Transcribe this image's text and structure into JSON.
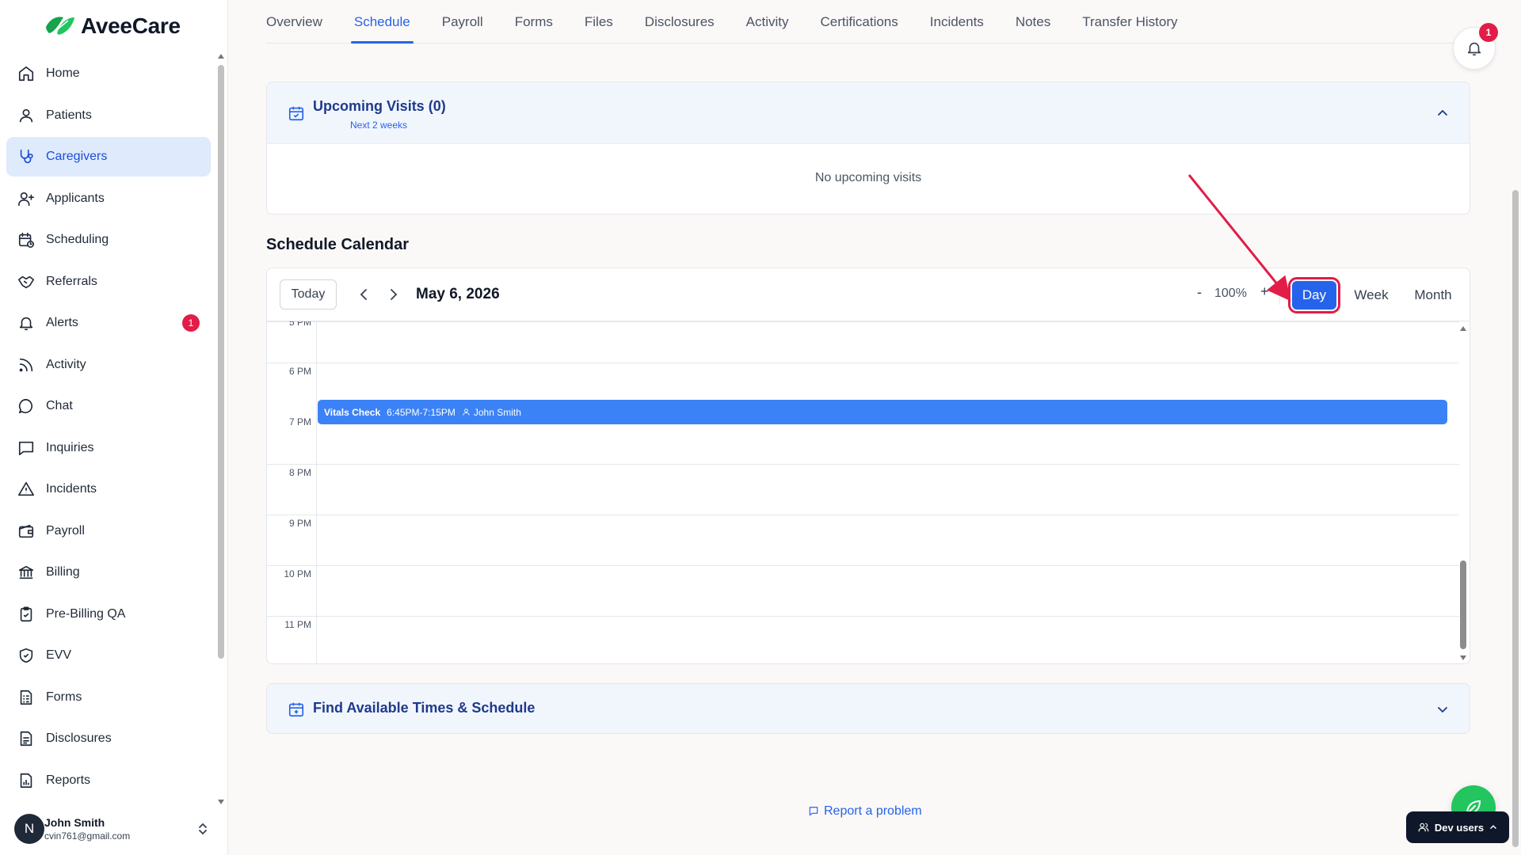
{
  "app": {
    "brand": "AveeCare"
  },
  "sidebar": {
    "items": [
      {
        "label": "Home",
        "icon": "home-icon"
      },
      {
        "label": "Patients",
        "icon": "user-icon"
      },
      {
        "label": "Caregivers",
        "icon": "stethoscope-icon",
        "active": true
      },
      {
        "label": "Applicants",
        "icon": "user-plus-icon"
      },
      {
        "label": "Scheduling",
        "icon": "calendar-clock-icon"
      },
      {
        "label": "Referrals",
        "icon": "handshake-icon"
      },
      {
        "label": "Alerts",
        "icon": "bell-icon",
        "badge": "1"
      },
      {
        "label": "Activity",
        "icon": "rss-icon"
      },
      {
        "label": "Chat",
        "icon": "chat-bubble-icon"
      },
      {
        "label": "Inquiries",
        "icon": "message-square-icon"
      },
      {
        "label": "Incidents",
        "icon": "warning-triangle-icon"
      },
      {
        "label": "Payroll",
        "icon": "wallet-icon"
      },
      {
        "label": "Billing",
        "icon": "bank-icon"
      },
      {
        "label": "Pre-Billing QA",
        "icon": "clipboard-check-icon"
      },
      {
        "label": "EVV",
        "icon": "shield-check-icon"
      },
      {
        "label": "Forms",
        "icon": "form-icon"
      },
      {
        "label": "Disclosures",
        "icon": "document-icon"
      },
      {
        "label": "Reports",
        "icon": "report-icon"
      }
    ],
    "user": {
      "initial": "N",
      "name": "John Smith",
      "email": "cvin761@gmail.com"
    }
  },
  "tabs": [
    {
      "label": "Overview"
    },
    {
      "label": "Schedule",
      "active": true
    },
    {
      "label": "Payroll"
    },
    {
      "label": "Forms"
    },
    {
      "label": "Files"
    },
    {
      "label": "Disclosures"
    },
    {
      "label": "Activity"
    },
    {
      "label": "Certifications"
    },
    {
      "label": "Incidents"
    },
    {
      "label": "Notes"
    },
    {
      "label": "Transfer History"
    }
  ],
  "notifications": {
    "count": "1"
  },
  "upcoming": {
    "title": "Upcoming Visits (0)",
    "subtitle": "Next 2 weeks",
    "empty_text": "No upcoming visits"
  },
  "calendar": {
    "section_title": "Schedule Calendar",
    "today_label": "Today",
    "date": "May 6, 2026",
    "zoom_minus": "-",
    "zoom": "100%",
    "zoom_plus": "+",
    "views": {
      "day": "Day",
      "week": "Week",
      "month": "Month"
    },
    "active_view": "Day",
    "hours": [
      "5 PM",
      "6 PM",
      "7 PM",
      "8 PM",
      "9 PM",
      "10 PM",
      "11 PM"
    ],
    "event": {
      "title": "Vitals Check",
      "time": "6:45PM-7:15PM",
      "person": "John Smith"
    }
  },
  "find": {
    "title": "Find Available Times & Schedule"
  },
  "footer": {
    "report": "Report a problem",
    "dev_users": "Dev users"
  },
  "colors": {
    "accent": "#2563eb",
    "event": "#3b82f6",
    "badge": "#e11d48",
    "highlight": "#e11d48",
    "fab": "#22c55e"
  }
}
